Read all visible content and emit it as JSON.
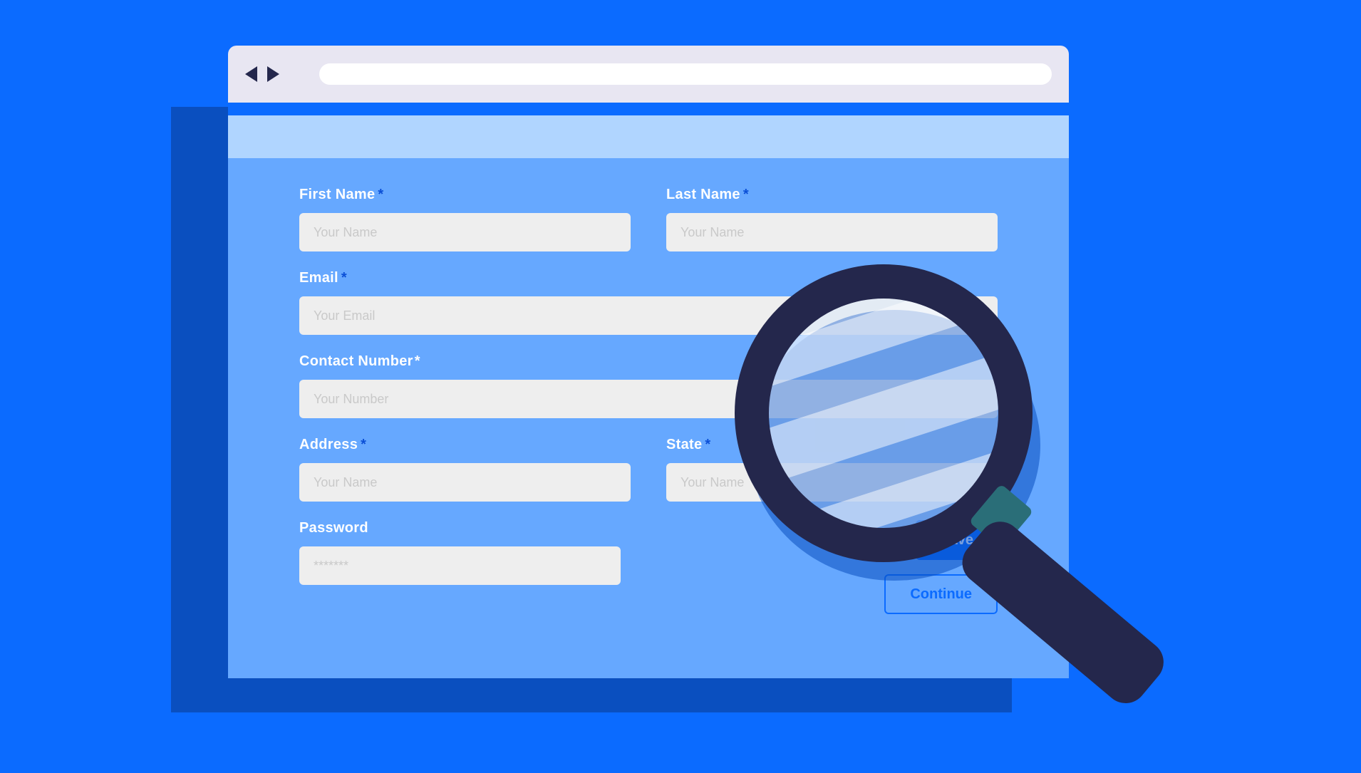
{
  "form": {
    "fields": {
      "first_name": {
        "label": "First Name",
        "placeholder": "Your Name",
        "required": true
      },
      "last_name": {
        "label": "Last Name",
        "placeholder": "Your Name",
        "required": true
      },
      "email": {
        "label": "Email",
        "placeholder": "Your Email",
        "required": true
      },
      "contact": {
        "label": "Contact  Number",
        "placeholder": "Your Number",
        "required": true
      },
      "address": {
        "label": "Address",
        "placeholder": "Your Name",
        "required": true
      },
      "state": {
        "label": "State",
        "placeholder": "Your Name",
        "required": true
      },
      "password": {
        "label": "Password",
        "placeholder": "*******",
        "required": false
      }
    },
    "buttons": {
      "save": "Save",
      "continue": "Continue"
    }
  },
  "asterisk": "*"
}
